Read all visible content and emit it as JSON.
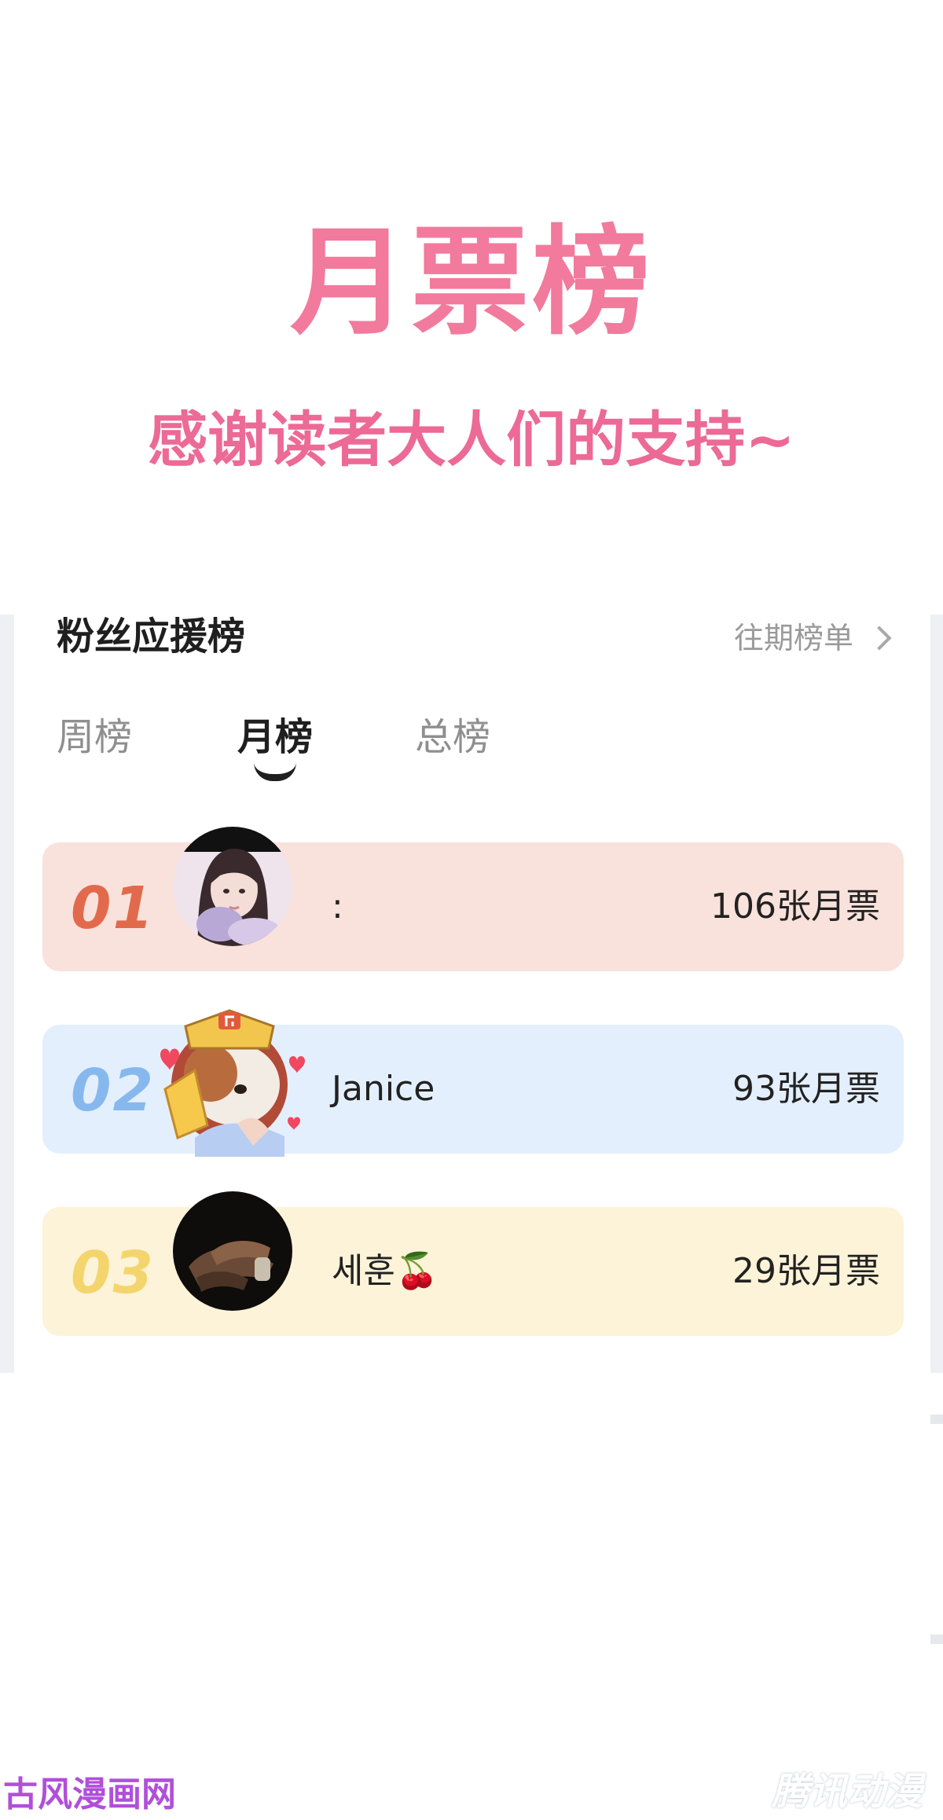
{
  "banner": {
    "title": "月票榜",
    "subtitle": "感谢读者大人们的支持~"
  },
  "panel": {
    "title": "粉丝应援榜",
    "history_link": "往期榜单",
    "tabs": [
      {
        "label": "周榜",
        "active": false
      },
      {
        "label": "月榜",
        "active": true
      },
      {
        "label": "总榜",
        "active": false
      }
    ]
  },
  "ranking": [
    {
      "rank": "01",
      "name": ":",
      "votes": "106张月票",
      "row_color": "#f9e2dc",
      "rank_color": "#e26a4c"
    },
    {
      "rank": "02",
      "name": "Janice",
      "votes": "93张月票",
      "row_color": "#e4effd",
      "rank_color": "#86b8ee"
    },
    {
      "rank": "03",
      "name": "세훈🍒",
      "votes": "29张月票",
      "row_color": "#fcf3d8",
      "rank_color": "#f4d56d"
    }
  ],
  "watermarks": {
    "left": "古风漫画网",
    "right": "腾讯动漫"
  }
}
